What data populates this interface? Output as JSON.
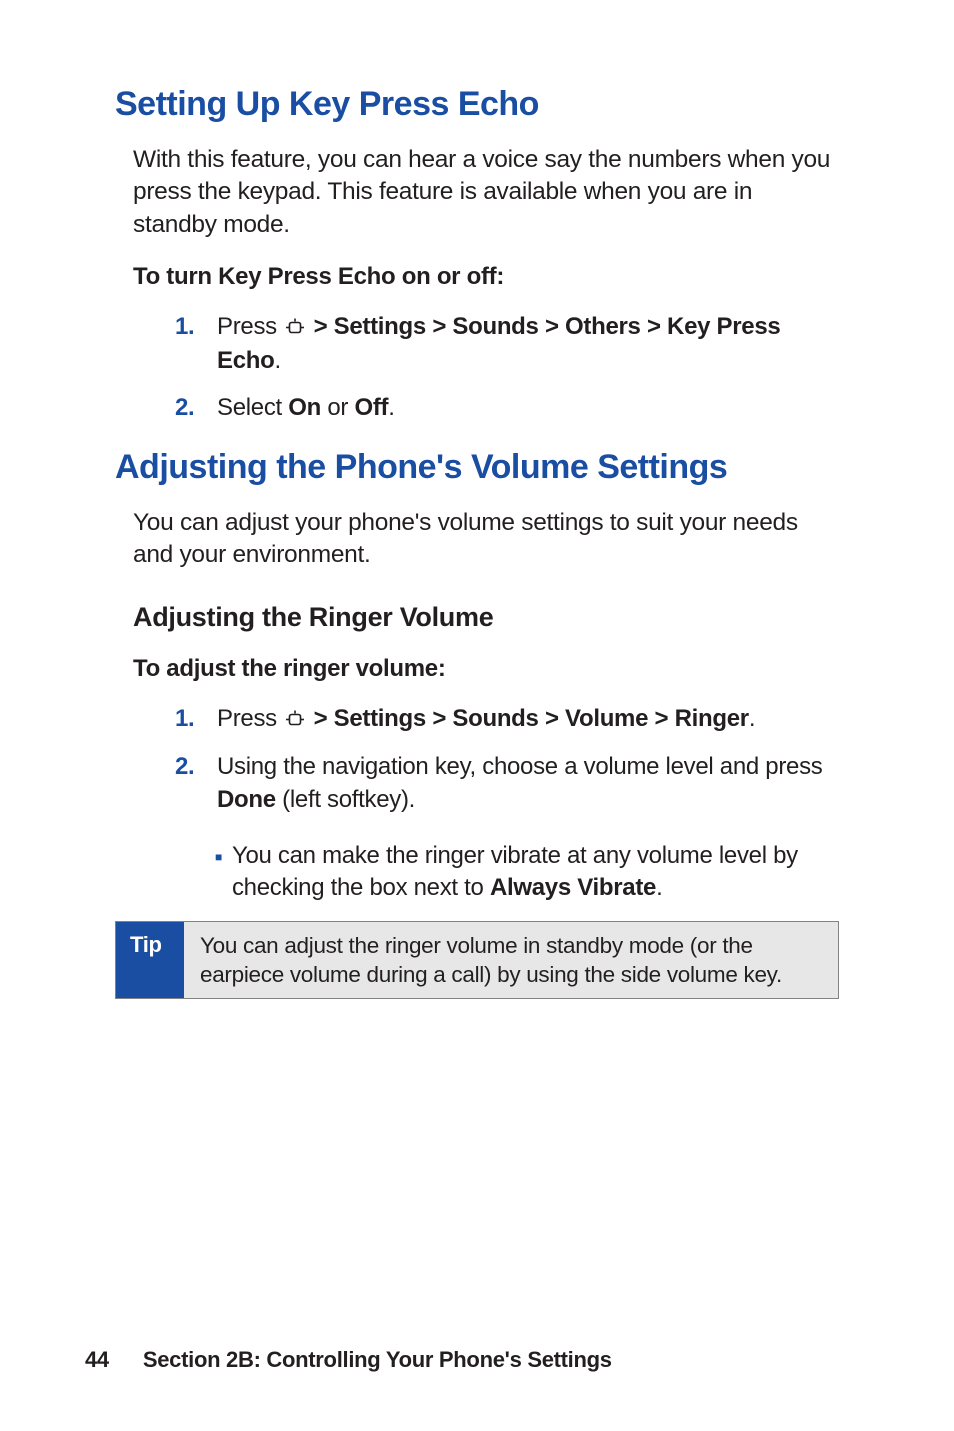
{
  "section1": {
    "heading": "Setting Up Key Press Echo",
    "intro": "With this feature, you can hear a voice say the numbers when you press the keypad. This feature is available when you are in standby mode.",
    "instr_label": "To turn Key Press Echo on or off:",
    "step1_prefix": "Press ",
    "step1_bold": " > Settings > Sounds > Others > Key Press Echo",
    "step1_suffix": ".",
    "step2_prefix": "Select ",
    "step2_b1": "On",
    "step2_mid": " or ",
    "step2_b2": "Off",
    "step2_suffix": "."
  },
  "section2": {
    "heading": "Adjusting the Phone's Volume Settings",
    "intro": "You can adjust your phone's volume settings to suit your needs and your environment.",
    "subheading": "Adjusting the Ringer Volume",
    "instr_label": "To adjust the ringer volume:",
    "step1_prefix": "Press ",
    "step1_bold": " > Settings > Sounds > Volume > Ringer",
    "step1_suffix": ".",
    "step2_prefix": "Using the navigation key, choose a volume level and press ",
    "step2_bold": "Done",
    "step2_suffix": " (left softkey).",
    "bullet_prefix": "You can make the ringer vibrate at any volume level by checking the box next to ",
    "bullet_bold": "Always Vibrate",
    "bullet_suffix": "."
  },
  "tip": {
    "label": "Tip",
    "text": "You can adjust the ringer volume in standby mode (or the earpiece volume during a call) by using the side volume key."
  },
  "footer": {
    "page": "44",
    "section": "Section 2B: Controlling Your Phone's Settings"
  },
  "numbers": {
    "n1": "1.",
    "n2": "2."
  }
}
